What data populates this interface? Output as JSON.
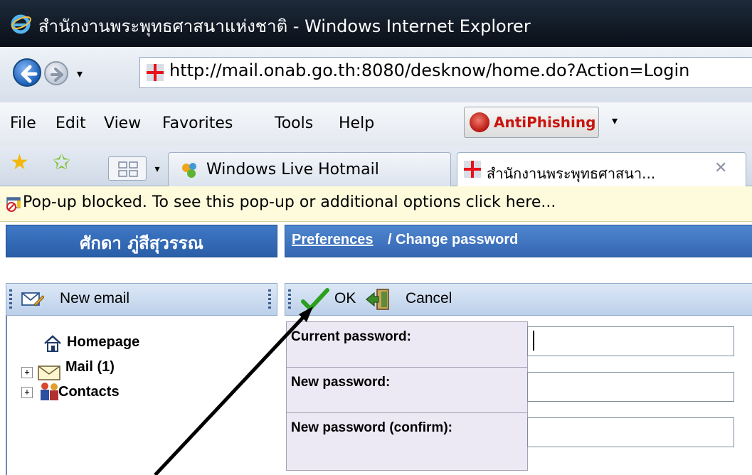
{
  "window": {
    "title": "สำนักงานพระพุทธศาสนาแห่งชาติ - Windows Internet Explorer"
  },
  "address_bar": {
    "url": "http://mail.onab.go.th:8080/desknow/home.do?Action=Login"
  },
  "menu": {
    "items": [
      "File",
      "Edit",
      "View",
      "Favorites",
      "Tools",
      "Help"
    ],
    "antiphishing": {
      "prefix": "Anti",
      "suffix": "Phishing"
    }
  },
  "tabs": [
    {
      "label": "Windows Live Hotmail",
      "active": false
    },
    {
      "label": "สำนักงานพระพุทธศาสนา...",
      "active": true,
      "close_glyph": "✕"
    }
  ],
  "infobar": {
    "text": "Pop-up blocked. To see this pop-up or additional options click here..."
  },
  "left_panel": {
    "user_name": "ศักดา ภู่สีสุวรรณ",
    "toolbar": {
      "new_email_label": "New email"
    },
    "tree": [
      {
        "label": "Homepage",
        "icon": "home-icon"
      },
      {
        "label": "Mail (1)",
        "icon": "mail-icon",
        "expander": "+"
      },
      {
        "label": "Contacts",
        "icon": "contacts-icon",
        "expander": "+"
      }
    ]
  },
  "right_panel": {
    "breadcrumb": {
      "link": "Preferences",
      "rest": " / Change password"
    },
    "toolbar": {
      "ok_label": "OK",
      "cancel_label": "Cancel"
    },
    "form": {
      "current_password_label": "Current password:",
      "new_password_label": "New password:",
      "confirm_password_label": "New password (confirm):",
      "current_password_value": "",
      "new_password_value": "",
      "confirm_password_value": ""
    }
  },
  "colors": {
    "panel_header": "#2a5ea8",
    "toolbar": "#bcd0ea",
    "infobar": "#fdfbdc",
    "label_bg": "#ede9f4",
    "antiphishing_red": "#c8150e"
  }
}
